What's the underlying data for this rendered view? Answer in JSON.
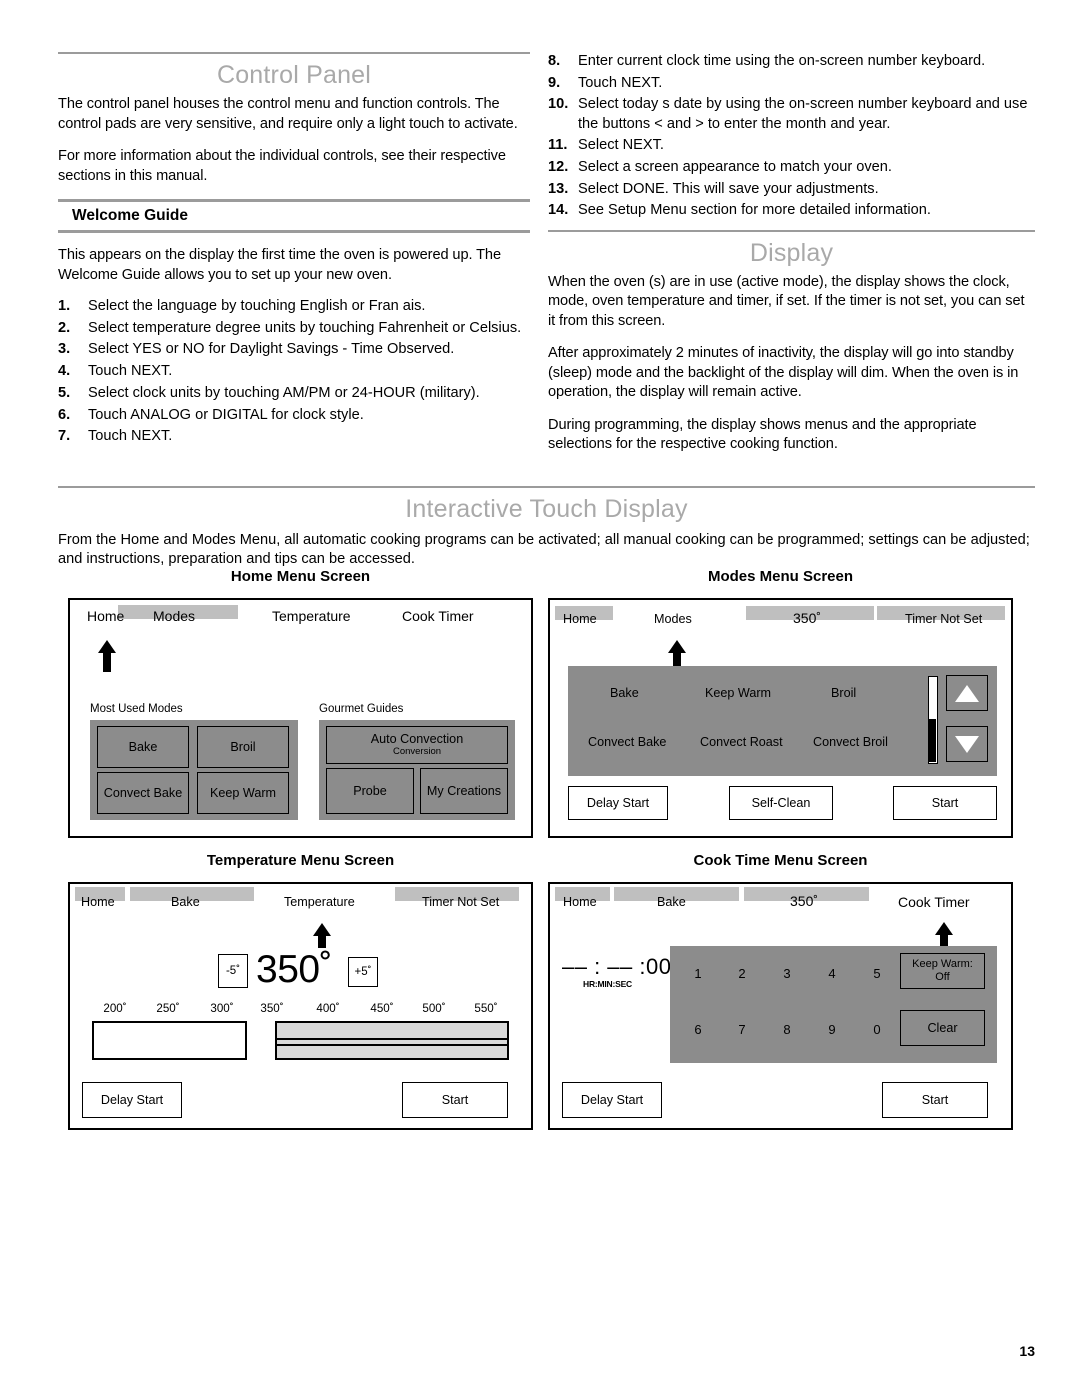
{
  "page_number": "13",
  "left_column": {
    "section_title": "Control Panel",
    "paragraphs": [
      "The control panel houses the control menu and function controls. The control pads are very sensitive, and require only a light touch to activate.",
      "For more information about the individual controls, see their respective sections in this manual."
    ],
    "subsection_title": "Welcome Guide",
    "intro": "This appears on the display the first time the oven is powered up. The Welcome Guide allows you to set up your new oven.",
    "steps": [
      {
        "num": "1.",
        "text": "Select the language by touching English or Fran ais."
      },
      {
        "num": "2.",
        "text": "Select temperature degree units by touching Fahrenheit or Celsius."
      },
      {
        "num": "3.",
        "text": "Select YES or NO for Daylight Savings - Time Observed."
      },
      {
        "num": "4.",
        "text": "Touch NEXT."
      },
      {
        "num": "5.",
        "text": "Select clock units by touching AM/PM or 24-HOUR (military)."
      },
      {
        "num": "6.",
        "text": "Touch ANALOG or DIGITAL for clock style."
      },
      {
        "num": "7.",
        "text": "Touch NEXT."
      }
    ]
  },
  "right_column": {
    "steps": [
      {
        "num": "8.",
        "text": "Enter current clock time using the on-screen number keyboard."
      },
      {
        "num": "9.",
        "text": "Touch NEXT."
      },
      {
        "num": "10.",
        "text": "Select today s date by using the on-screen number keyboard and use the buttons  <  and  >  to enter the month and year."
      },
      {
        "num": "11.",
        "text": "Select NEXT."
      },
      {
        "num": "12.",
        "text": "Select a screen appearance to match your oven."
      },
      {
        "num": "13.",
        "text": "Select DONE. This will save your adjustments."
      },
      {
        "num": "14.",
        "text": "See  Setup Menu  section for more detailed information."
      }
    ],
    "section_title": "Display",
    "paragraphs": [
      "When the oven (s) are in use (active mode), the display shows the clock, mode, oven temperature and timer, if set. If the timer is not set, you can set it from this screen.",
      "After approximately 2 minutes of inactivity, the display will go into standby (sleep) mode and the backlight of the display will dim. When the oven is in operation, the display will remain active.",
      "During programming, the display shows menus and the appropriate selections for the respective cooking function."
    ]
  },
  "interactive_section": {
    "title": "Interactive Touch Display",
    "intro": "From the Home and Modes Menu, all automatic cooking programs can  be activated; all manual cooking can be programmed; settings can be adjusted; and instructions, preparation and tips can be accessed."
  },
  "screens": {
    "home": {
      "caption": "Home Menu Screen",
      "tabs": [
        "Home",
        "Modes",
        "Temperature",
        "Cook Timer"
      ],
      "active_tab": "Home",
      "group_left_label": "Most Used Modes",
      "group_right_label": "Gourmet Guides",
      "most_used_modes": [
        "Bake",
        "Broil",
        "Convect Bake",
        "Keep Warm"
      ],
      "gourmet_guides": {
        "auto_convection": "Auto Convection",
        "auto_convection_sub": "Conversion",
        "probe": "Probe",
        "my_creations": "My Creations"
      }
    },
    "modes": {
      "caption": "Modes Menu Screen",
      "tabs": [
        "Home",
        "Modes",
        "350˚",
        "Timer Not Set"
      ],
      "active_tab": "Modes",
      "mode_list": [
        "Bake",
        "Keep Warm",
        "Broil",
        "Convect Bake",
        "Convect Roast",
        "Convect Broil"
      ],
      "scroll_up_icon": "triangle-up-icon",
      "scroll_down_icon": "triangle-down-icon",
      "footer_buttons": [
        "Delay Start",
        "Self-Clean",
        "Start"
      ]
    },
    "temperature": {
      "caption": "Temperature Menu Screen",
      "tabs": [
        "Home",
        "Bake",
        "Temperature",
        "Timer Not Set"
      ],
      "active_tab": "Temperature",
      "decrement_label": "-5˚",
      "current_value": "350˚",
      "increment_label": "+5˚",
      "scale_labels": [
        "200˚",
        "250˚",
        "300˚",
        "350˚",
        "400˚",
        "450˚",
        "500˚",
        "550˚"
      ],
      "slider_value": "350",
      "footer_buttons": [
        "Delay Start",
        "Start"
      ]
    },
    "cook_time": {
      "caption": "Cook Time Menu Screen",
      "tabs": [
        "Home",
        "Bake",
        "350˚",
        "Cook Timer"
      ],
      "active_tab": "Cook Timer",
      "timer_display": "–– : –– :00",
      "timer_sub": "HR:MIN:SEC",
      "keypad_row1": [
        "1",
        "2",
        "3",
        "4",
        "5"
      ],
      "keypad_row2": [
        "6",
        "7",
        "8",
        "9",
        "0"
      ],
      "keep_warm_label": "Keep Warm:",
      "keep_warm_value": "Off",
      "clear_label": "Clear",
      "footer_buttons": [
        "Delay Start",
        "Start"
      ]
    }
  }
}
